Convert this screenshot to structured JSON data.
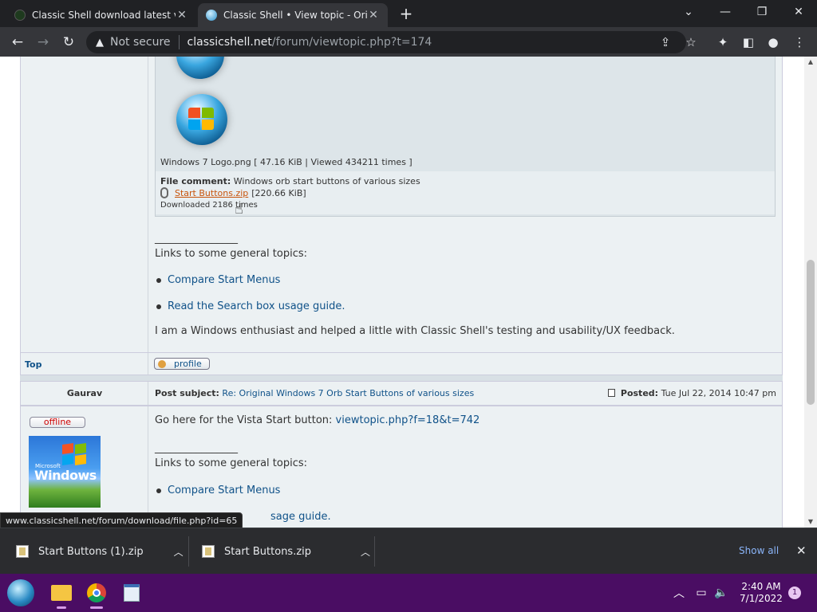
{
  "browser": {
    "tabs": [
      {
        "title": "Classic Shell download latest ver",
        "active": false
      },
      {
        "title": "Classic Shell • View topic - Origin",
        "active": true
      }
    ],
    "address": {
      "security": "Not secure",
      "host": "classicshell.net",
      "path": "/forum/viewtopic.php?t=174"
    }
  },
  "attachment": {
    "image_caption": "Windows 7 Logo.png [ 47.16 KiB | Viewed 434211 times ]",
    "file_comment_label": "File comment:",
    "file_comment_text": "Windows orb start buttons of various sizes",
    "file_link": "Start Buttons.zip",
    "file_size": "[220.66 KiB]",
    "downloads_prefix": "Downloaded",
    "downloads_count": "2186",
    "downloads_suffix": "times"
  },
  "post1": {
    "signature_rule": "________________",
    "signature_intro": "Links to some general topics:",
    "links": [
      "Compare Start Menus",
      "Read the Search box usage guide."
    ],
    "signature_text": "I am a Windows enthusiast and helped a little with Classic Shell's testing and usability/UX feedback.",
    "top_label": "Top",
    "profile_label": "profile"
  },
  "post2": {
    "author": "Gaurav",
    "status": "offline",
    "avatar_text_small": "Microsoft",
    "avatar_text": "Windows",
    "subject_label": "Post subject:",
    "subject": "Re: Original Windows 7 Orb Start Buttons of various sizes",
    "posted_label": "Posted:",
    "posted": "Tue Jul 22, 2014 10:47 pm",
    "body_prefix": "Go here for the Vista Start button:",
    "body_link": "viewtopic.php?f=18&t=742",
    "signature_rule": "________________",
    "signature_intro": "Links to some general topics:",
    "links": [
      "Compare Start Menus",
      "sage guide."
    ]
  },
  "status_url": "www.classicshell.net/forum/download/file.php?id=65",
  "downloads_shelf": {
    "items": [
      "Start Buttons (1).zip",
      "Start Buttons.zip"
    ],
    "show_all": "Show all"
  },
  "taskbar": {
    "time": "2:40 AM",
    "date": "7/1/2022",
    "notification_count": "1"
  },
  "colors": {
    "link": "#105289",
    "taskbar": "#4a0d63",
    "offline": "#cc0000"
  }
}
